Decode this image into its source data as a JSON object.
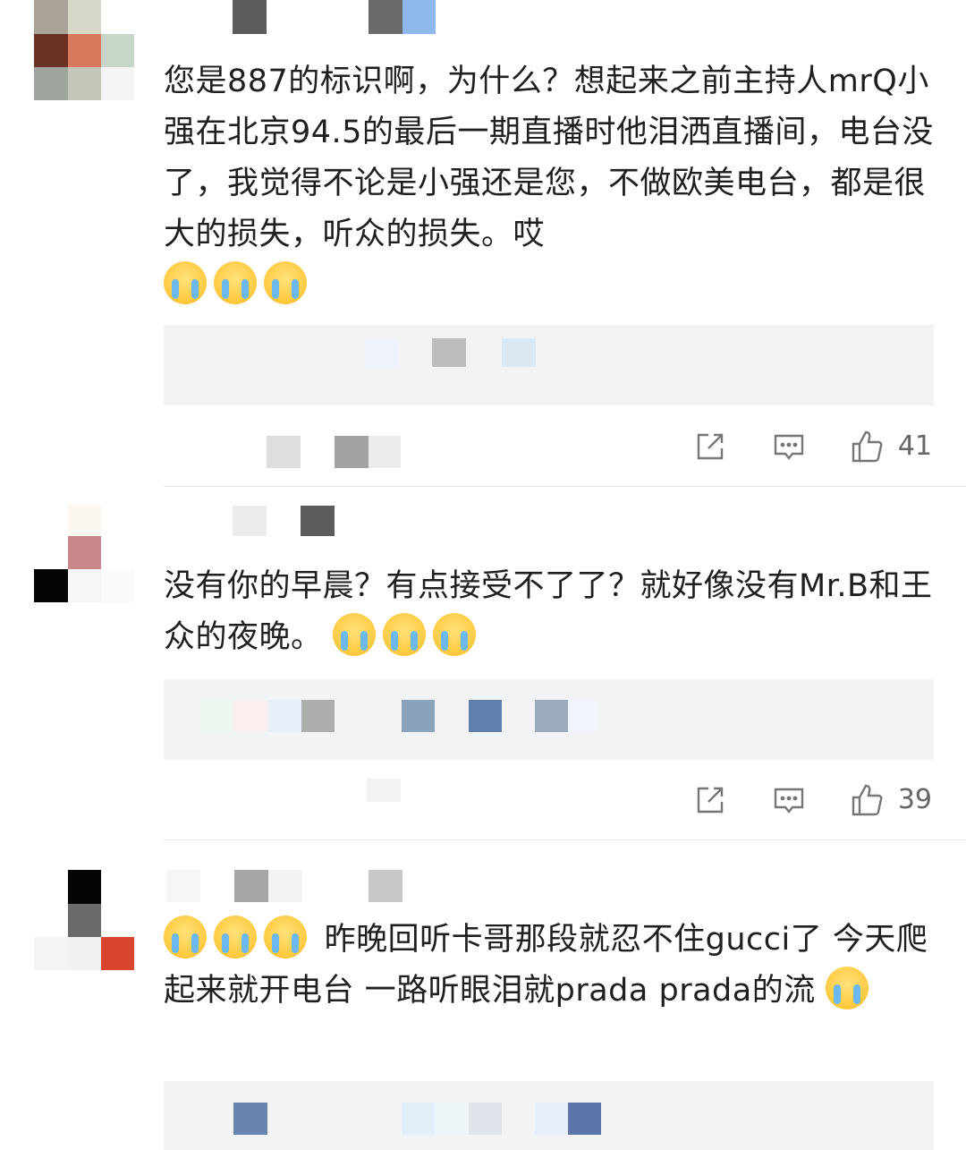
{
  "comments": [
    {
      "text": "您是887的标识啊，为什么？想起来之前主持人mrQ小强在北京94.5的最后一期直播时他泪洒直播间，电台没了，我觉得不论是小强还是您，不做欧美电台，都是很大的损失，听众的损失。哎",
      "emoji_count_label": "😭😭😭",
      "like_count": "41"
    },
    {
      "text": "没有你的早晨？有点接受不了了？就好像没有Mr.B和王众的夜晚。",
      "emoji_count_label": "🥹🥹🥹",
      "like_count": "39"
    },
    {
      "text_prefix_emoji": "😭😭😭",
      "text": "昨晚回听卡哥那段就忍不住gucci了 今天爬起来就开电台 一路听眼泪就prada prada的流",
      "text_suffix_emoji": "😭"
    }
  ],
  "icons": {
    "share": "share-icon",
    "reply": "reply-icon",
    "like": "thumbs-up-icon"
  },
  "colors": {
    "text": "#1f1f1f",
    "reply_bg": "#f2f3f5",
    "icon": "#777777",
    "divider": "#e6e6e6"
  }
}
